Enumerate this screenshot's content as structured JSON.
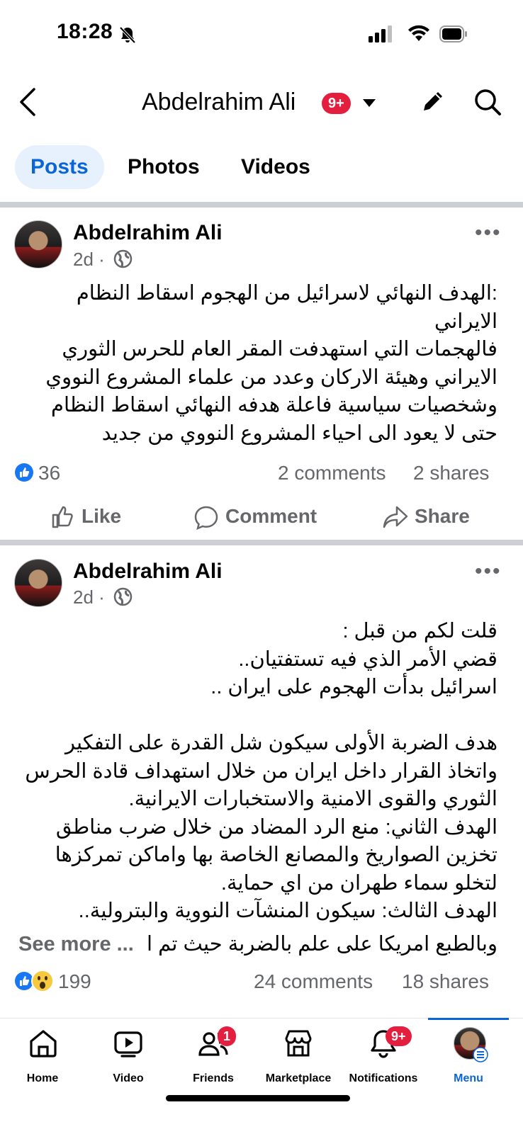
{
  "status_bar": {
    "time": "18:28"
  },
  "header": {
    "title": "Abdelrahim Ali",
    "badge": "9+"
  },
  "tabs": [
    {
      "label": "Posts",
      "active": true
    },
    {
      "label": "Photos",
      "active": false
    },
    {
      "label": "Videos",
      "active": false
    }
  ],
  "posts": [
    {
      "author": "Abdelrahim Ali",
      "time": "2d ·",
      "text": ":الهدف النهائي لاسرائيل من الهجوم اسقاط النظام\nالايراني\nفالهجمات التي استهدفت المقر العام للحرس الثوري\nالايراني وهيئة الاركان وعدد من علماء المشروع النووي\nوشخصيات سياسية فاعلة هدفه النهائي اسقاط النظام\nحتى لا يعود الى احياء المشروع النووي من جديد",
      "reactions": "36",
      "comments": "2 comments",
      "shares": "2 shares"
    },
    {
      "author": "Abdelrahim Ali",
      "time": "2d ·",
      "text": "قلت لكم من قبل :\nقضي الأمر الذي فيه تستفتيان..\nاسرائيل بدأت الهجوم على ايران ..\n\nهدف الضربة الأولى سيكون شل القدرة على التفكير\nواتخاذ القرار داخل ايران من خلال استهداف قادة الحرس\nالثوري والقوى الامنية والاستخبارات الايرانية.\nالهدف الثاني: منع الرد المضاد من خلال ضرب مناطق\nتخزين الصواريخ والمصانع الخاصة بها واماكن تمركزها\nلتخلو سماء طهران من اي حماية.\nالهدف الثالث: سيكون المنشآت النووية والبترولية..",
      "last_line": "وبالطبع امريكا على علم بالضربة حيث تم ا",
      "see_more": "See more ...",
      "reactions": "199",
      "comments": "24 comments",
      "shares": "18 shares"
    }
  ],
  "actions": {
    "like": "Like",
    "comment": "Comment",
    "share": "Share"
  },
  "bottom_nav": [
    {
      "label": "Home",
      "icon": "home-icon"
    },
    {
      "label": "Video",
      "icon": "video-icon"
    },
    {
      "label": "Friends",
      "icon": "friends-icon",
      "badge": "1"
    },
    {
      "label": "Marketplace",
      "icon": "marketplace-icon"
    },
    {
      "label": "Notifications",
      "icon": "bell-icon",
      "badge": "9+"
    },
    {
      "label": "Menu",
      "icon": "menu-avatar",
      "active": true
    }
  ],
  "colors": {
    "accent": "#0b65d8",
    "badge": "#e41e3f",
    "like": "#1877f2"
  }
}
